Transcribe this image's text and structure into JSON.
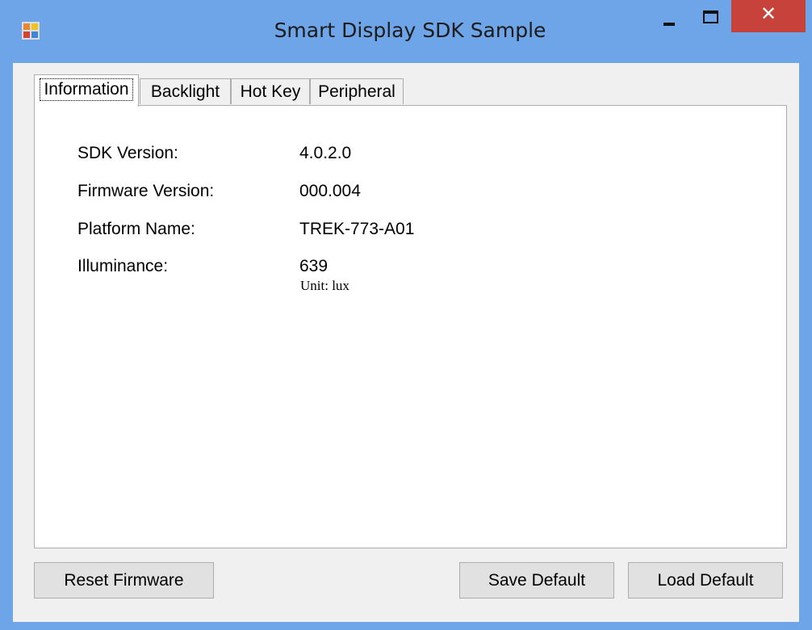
{
  "window": {
    "title": "Smart Display SDK Sample",
    "app_icon": "app-icon",
    "close_glyph": "✕"
  },
  "tabs": [
    {
      "label": "Information",
      "active": true
    },
    {
      "label": "Backlight",
      "active": false
    },
    {
      "label": "Hot Key",
      "active": false
    },
    {
      "label": "Peripheral",
      "active": false
    }
  ],
  "information": {
    "sdk_version_label": "SDK Version:",
    "sdk_version_value": "4.0.2.0",
    "firmware_version_label": "Firmware Version:",
    "firmware_version_value": "000.004",
    "platform_name_label": "Platform Name:",
    "platform_name_value": "TREK-773-A01",
    "illuminance_label": "Illuminance:",
    "illuminance_value": "639",
    "illuminance_unit": "Unit: lux"
  },
  "buttons": {
    "reset_firmware": "Reset Firmware",
    "save_default": "Save Default",
    "load_default": "Load Default"
  },
  "colors": {
    "title_bar": "#6ea5e8",
    "close_button": "#c7423a",
    "client_background": "#f0f0f0"
  }
}
